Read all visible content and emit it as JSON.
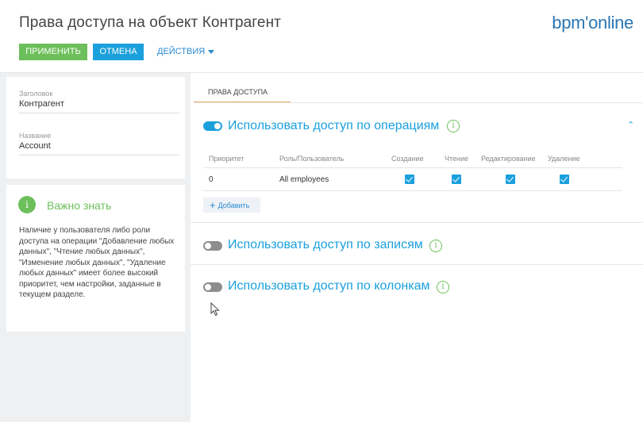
{
  "header": {
    "title": "Права доступа на объект Контрагент",
    "logo": "bpm'online",
    "buttons": {
      "apply": "ПРИМЕНИТЬ",
      "cancel": "ОТМЕНА",
      "actions": "ДЕЙСТВИЯ"
    }
  },
  "fields": [
    {
      "label": "Заголовок",
      "value": "Контрагент"
    },
    {
      "label": "Название",
      "value": "Account"
    }
  ],
  "info": {
    "icon": "info-icon",
    "title": "Важно знать",
    "text": "Наличие у пользователя либо роли доступа на операции \"Добавление любых данных\", \"Чтение любых данных\", \"Изменение любых данных\", \"Удаление любых данных\" имеет более высокий приоритет, чем настройки, заданные в текущем разделе."
  },
  "tabs": [
    {
      "label": "ПРАВА ДОСТУПА",
      "active": true
    }
  ],
  "operations": {
    "title": "Использовать доступ по операциям",
    "enabled": true,
    "columns": [
      "Приоритет",
      "Роль/Пользователь",
      "Создание",
      "Чтение",
      "Редактирование",
      "Удаление"
    ],
    "rows": [
      {
        "priority": "0",
        "role": "All employees",
        "create": true,
        "read": true,
        "edit": true,
        "delete": true
      }
    ],
    "add_label": "Добавить"
  },
  "records": {
    "title": "Использовать доступ по записям",
    "enabled": false
  },
  "columns_access": {
    "title": "Использовать доступ по колонкам",
    "enabled": false
  },
  "colors": {
    "accent": "#1ba0dc",
    "green": "#6cbf5a",
    "tab_underline": "#e8a66a"
  }
}
